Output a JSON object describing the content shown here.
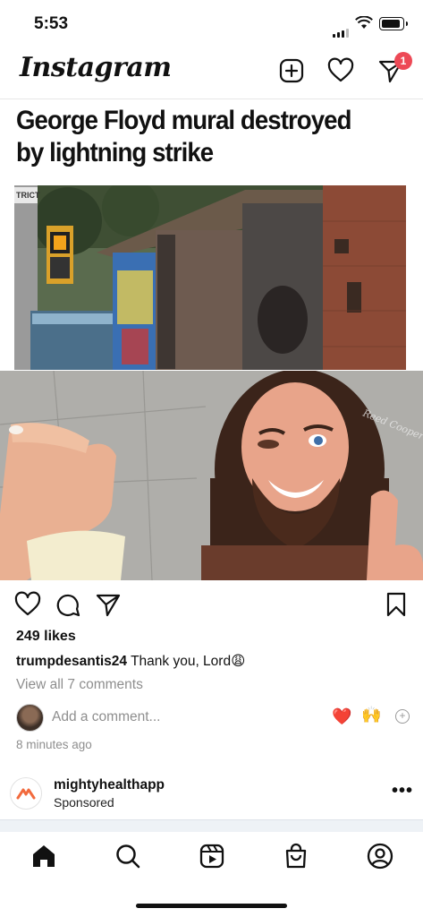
{
  "status_bar": {
    "time": "5:53"
  },
  "header": {
    "app_name": "Instagram",
    "dm_badge_count": "1"
  },
  "post": {
    "headline": "George Floyd mural destroyed by lightning strike",
    "sign_text": "TRICT",
    "watermark": "Reed Cooper",
    "likes": "249 likes",
    "caption_user": "trumpdesantis24",
    "caption_text": " Thank you, Lord😩",
    "view_comments": "View all 7 comments",
    "comment_placeholder": "Add a comment...",
    "quick_reactions": [
      "❤️",
      "🙌"
    ],
    "timestamp": "8 minutes ago"
  },
  "sponsored": {
    "name": "mightyhealthapp",
    "label": "Sponsored",
    "more": "•••"
  },
  "bottom_nav": [
    "home",
    "search",
    "reels",
    "shop",
    "profile"
  ],
  "colors": {
    "badge": "#ed4956",
    "muted": "#8e8e8e",
    "brick": "#8c4a36",
    "skin": "#e8a48a"
  }
}
